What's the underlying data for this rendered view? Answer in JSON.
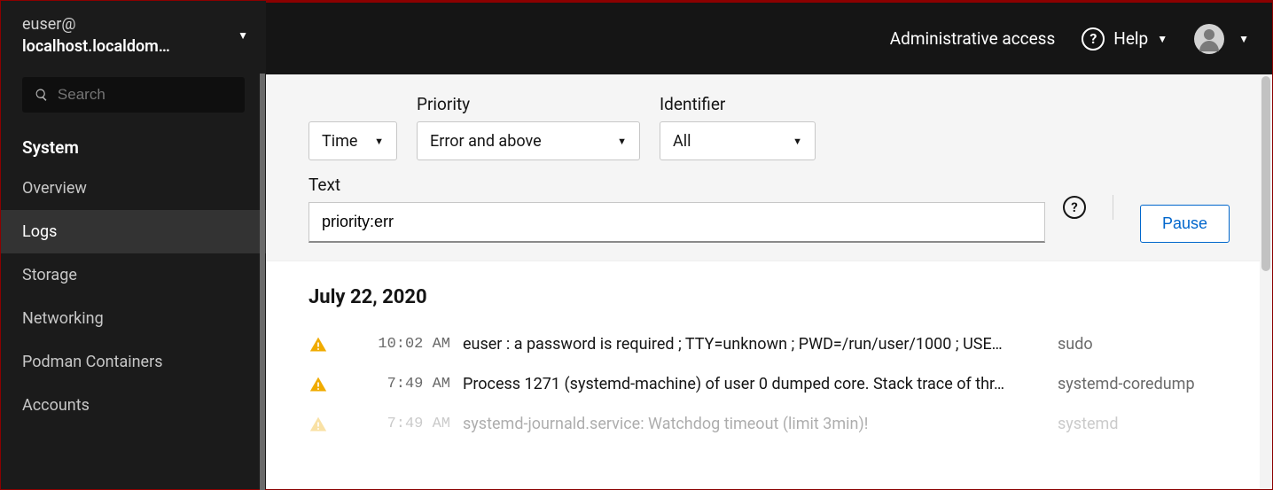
{
  "sidebar": {
    "user": "euser@",
    "host": "localhost.localdom…",
    "search_placeholder": "Search",
    "section": "System",
    "items": [
      {
        "label": "Overview",
        "active": false
      },
      {
        "label": "Logs",
        "active": true
      },
      {
        "label": "Storage",
        "active": false
      },
      {
        "label": "Networking",
        "active": false
      },
      {
        "label": "Podman Containers",
        "active": false
      },
      {
        "label": "Accounts",
        "active": false
      }
    ]
  },
  "topbar": {
    "admin": "Administrative access",
    "help": "Help"
  },
  "filters": {
    "time_label": "Time",
    "priority_label": "Priority",
    "priority_value": "Error and above",
    "identifier_label": "Identifier",
    "identifier_value": "All",
    "text_label": "Text",
    "text_value": "priority:err",
    "pause": "Pause"
  },
  "logs": {
    "date": "July 22, 2020",
    "entries": [
      {
        "time": "10:02 AM",
        "msg": "euser : a password is required ; TTY=unknown ; PWD=/run/user/1000 ; USE…",
        "src": "sudo"
      },
      {
        "time": "7:49 AM",
        "msg": "Process 1271 (systemd-machine) of user 0 dumped core. Stack trace of thr…",
        "src": "systemd-coredump"
      },
      {
        "time": "7:49 AM",
        "msg": "systemd-journald.service: Watchdog timeout (limit 3min)!",
        "src": "systemd"
      }
    ]
  }
}
